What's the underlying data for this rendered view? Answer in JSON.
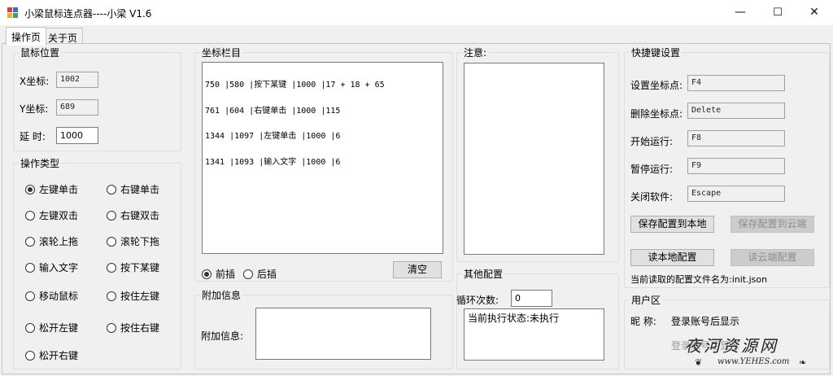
{
  "window": {
    "title": "小梁鼠标连点器----小梁 V1.6",
    "min": "—",
    "max": "☐",
    "close": "✕"
  },
  "tabs": [
    "操作页",
    "关于页"
  ],
  "mouse": {
    "legend": "鼠标位置",
    "x_label": "X坐标:",
    "x_value": "1002",
    "y_label": "Y坐标:",
    "y_value": "689",
    "delay_label": "延 时:",
    "delay_value": "1000"
  },
  "optype": {
    "legend": "操作类型",
    "left": [
      "左键单击",
      "左键双击",
      "滚轮上拖",
      "输入文字",
      "移动鼠标",
      "松开左键",
      "松开右键"
    ],
    "right": [
      "右键单击",
      "右键双击",
      "滚轮下拖",
      "按下某键",
      "按住左键",
      "按住右键"
    ],
    "selected": "左键单击"
  },
  "coords": {
    "legend": "坐标栏目",
    "lines": [
      "750 |580 |按下某键 |1000 |17 + 18 + 65",
      "761 |604 |右键单击 |1000 |115",
      "1344 |1097 |左键单击 |1000 |6",
      "1341 |1093 |输入文字 |1000 |6"
    ],
    "before_label": "前插",
    "after_label": "后插",
    "clear_label": "清空"
  },
  "extra": {
    "legend": "附加信息",
    "label": "附加信息:"
  },
  "notice": {
    "legend": "注意:"
  },
  "other": {
    "legend": "其他配置",
    "loop_label": "循环次数:",
    "loop_value": "0",
    "status_label": "当前执行状态:",
    "status_value": "未执行"
  },
  "hotkeys": {
    "legend": "快捷键设置",
    "items": [
      {
        "label": "设置坐标点:",
        "value": "F4"
      },
      {
        "label": "删除坐标点:",
        "value": "Delete"
      },
      {
        "label": "开始运行:",
        "value": "F8"
      },
      {
        "label": "暂停运行:",
        "value": "F9"
      },
      {
        "label": "关闭软件:",
        "value": "Escape"
      }
    ],
    "save_local": "保存配置到本地",
    "save_cloud": "保存配置到云端",
    "read_local": "读本地配置",
    "read_cloud": "读云端配置",
    "config_text": "当前读取的配置文件名为:init.json"
  },
  "user": {
    "legend": "用户区",
    "nick_label": "昵 称:",
    "nick_value": "登录账号后显示",
    "login_text": "登录账号后显示"
  },
  "watermark": {
    "title": "夜河资源网",
    "url": "www.YEHES.com"
  },
  "colors": {
    "icon_red": "#e03c31",
    "icon_blue": "#2f6fd0",
    "icon_yellow": "#f2b01e",
    "icon_green": "#3aa54a"
  }
}
